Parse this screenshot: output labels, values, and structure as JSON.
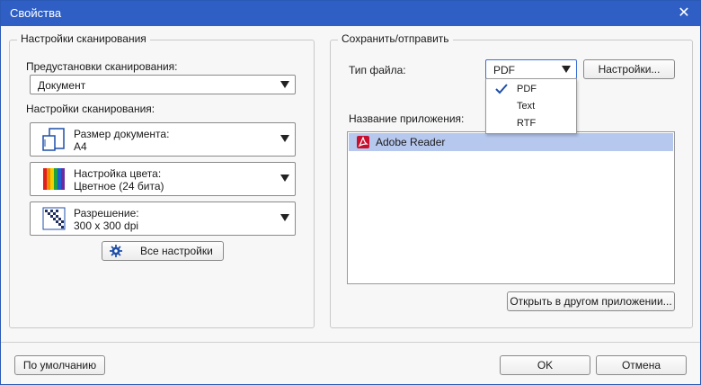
{
  "window": {
    "title": "Свойства"
  },
  "scan_group": {
    "legend": "Настройки сканирования",
    "preset_label": "Предустановки сканирования:",
    "preset_value": "Документ",
    "settings_label": "Настройки сканирования:",
    "document_size": {
      "title": "Размер документа:",
      "value": "A4",
      "icon": "document-size-icon"
    },
    "color": {
      "title": "Настройка цвета:",
      "value": "Цветное (24 бита)",
      "icon": "color-palette-icon"
    },
    "resolution": {
      "title": "Разрешение:",
      "value": "300 x 300 dpi",
      "icon": "resolution-grid-icon"
    },
    "all_settings_button": "Все настройки"
  },
  "save_group": {
    "legend": "Сохранить/отправить",
    "file_type_label": "Тип файла:",
    "file_type_value": "PDF",
    "settings_button": "Настройки...",
    "file_type_options": [
      "PDF",
      "Text",
      "RTF"
    ],
    "selected_option": "PDF",
    "app_label": "Название приложения:",
    "apps": [
      {
        "name": "Adobe Reader",
        "icon": "pdf-icon",
        "selected": true
      }
    ],
    "open_other_button": "Открыть в другом приложении..."
  },
  "footer": {
    "default_button": "По умолчанию",
    "ok_button": "OK",
    "cancel_button": "Отмена"
  },
  "colors": {
    "title_bar": "#2f5fc4",
    "selection": "#b7c8ee",
    "pdf_red": "#c8102e"
  }
}
